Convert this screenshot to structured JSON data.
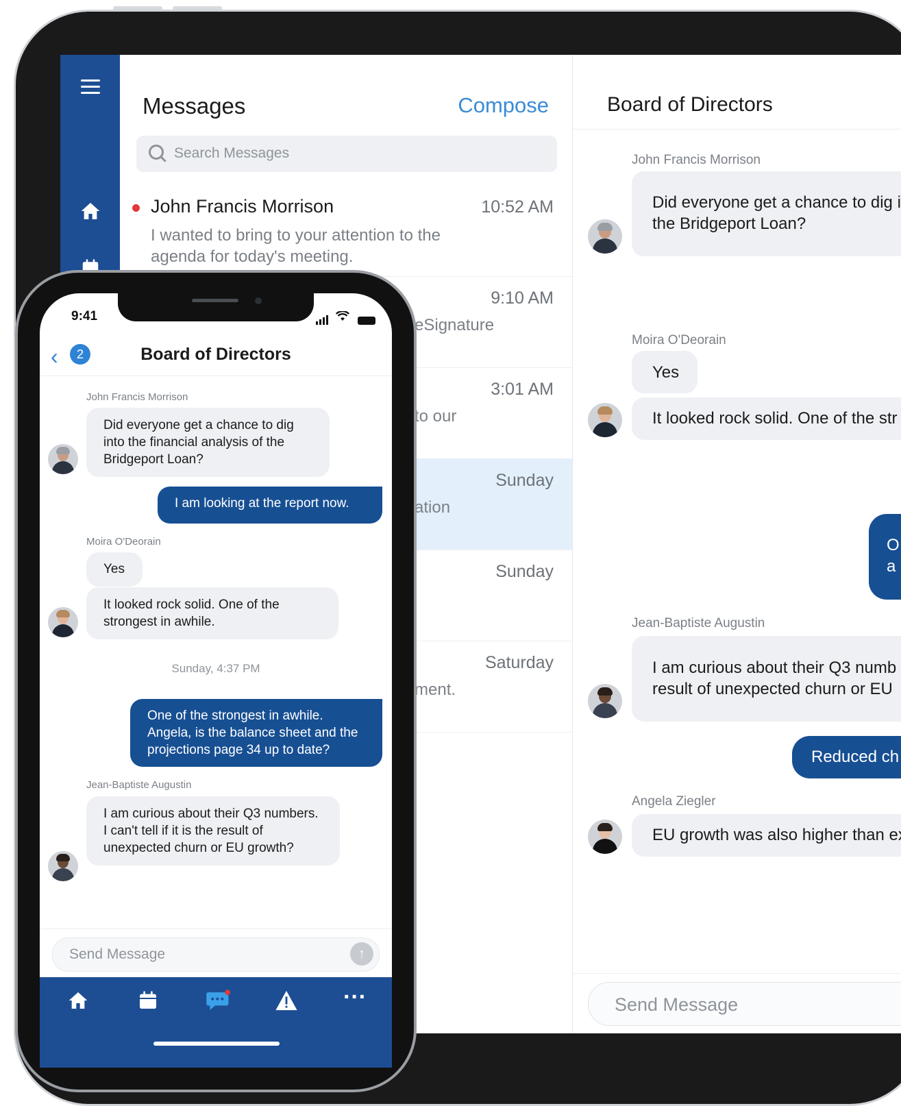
{
  "tablet": {
    "messages_title": "Messages",
    "compose_label": "Compose",
    "search_placeholder": "Search Messages",
    "threads": [
      {
        "name": "John Francis Morrison",
        "time": "10:52 AM",
        "preview": "I wanted to bring to your attention to the agenda for today's meeting.",
        "unread": true
      },
      {
        "name": "",
        "time": "9:10 AM",
        "preview_tail": "eSignature"
      },
      {
        "name": "",
        "time": "3:01 AM",
        "preview_tail": "to our"
      },
      {
        "name": "",
        "time": "Sunday",
        "preview_tail": "ation",
        "selected": true
      },
      {
        "name": "",
        "time": "Sunday",
        "preview_tail": ""
      },
      {
        "name": "",
        "time": "Saturday",
        "preview_tail": "ment."
      }
    ],
    "chat": {
      "title": "Board of Directors",
      "input_placeholder": "Send Message",
      "messages": [
        {
          "sender": "John Francis Morrison",
          "lines": [
            "Did everyone get a chance to dig i",
            "the Bridgeport Loan?"
          ]
        },
        {
          "sender": "Moira O'Deorain",
          "lines": [
            "Yes"
          ]
        },
        {
          "lines": [
            "It looked rock solid. One of the str"
          ]
        },
        {
          "outgoing": true,
          "lines": [
            "O",
            "a"
          ]
        },
        {
          "sender": "Jean-Baptiste Augustin",
          "lines": [
            "I am curious about their Q3 numb",
            "result of unexpected churn or EU"
          ]
        },
        {
          "outgoing": true,
          "lines": [
            "Reduced ch"
          ]
        },
        {
          "sender": "Angela Ziegler",
          "lines": [
            "EU growth was also higher than ex"
          ]
        }
      ]
    }
  },
  "phone": {
    "status_time": "9:41",
    "back_badge": "2",
    "title": "Board of Directors",
    "messages": [
      {
        "sender": "John Francis Morrison",
        "text": "Did everyone get a chance to dig into the financial analysis of the Bridgeport Loan?"
      },
      {
        "outgoing": true,
        "text": "I am looking at the report now."
      },
      {
        "sender": "Moira O'Deorain",
        "text": "Yes"
      },
      {
        "text": "It looked rock solid. One of the strongest in awhile."
      },
      {
        "outgoing": true,
        "text": "One of the strongest in awhile. Angela, is the balance sheet and the projections page 34 up to date?"
      },
      {
        "sender": "Jean-Baptiste Augustin",
        "text": "I am curious about their Q3 numbers. I can't tell if it is the result of unexpected churn or EU growth?"
      }
    ],
    "date_divider": "Sunday, 4:37 PM",
    "input_placeholder": "Send Message",
    "tabs": [
      "home-icon",
      "calendar-icon",
      "chat-icon",
      "alert-icon",
      "more-icon"
    ],
    "more_label": "···"
  },
  "colors": {
    "brand": "#1d4e93",
    "accent": "#3a8bd6",
    "outgoing_bubble": "#174f93",
    "incoming_bubble": "#eef0f3",
    "unread_dot": "#e23a3a",
    "selected_row": "#e3f0fb"
  }
}
